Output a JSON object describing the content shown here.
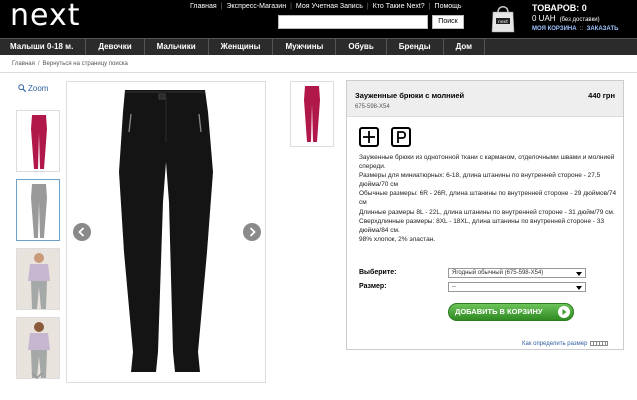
{
  "header": {
    "logo": "next",
    "top_links": [
      "Главная",
      "Экспресс-Магазин",
      "Моя Учетная Запись",
      "Кто Такие Next?",
      "Помощь"
    ],
    "search_button": "Поиск",
    "search_value": "",
    "cart_count": "ТОВАРОВ: 0",
    "cart_sum": "0 UAH",
    "cart_sum_note": "(без доставки)",
    "cart_links": [
      "МОЯ КОРЗИНА",
      "ЗАКАЗАТЬ"
    ]
  },
  "nav": {
    "items": [
      "Малыши 0-18 м.",
      "Девочки",
      "Мальчики",
      "Женщины",
      "Мужчины",
      "Обувь",
      "Бренды",
      "Дом"
    ]
  },
  "breadcrumb": [
    "Главная",
    "Вернуться на страницу поиска"
  ],
  "gallery": {
    "zoom_label": "Zoom"
  },
  "product": {
    "title": "Зауженные брюки с молнией",
    "price": "440 грн",
    "code": "675-598-X54",
    "description": [
      "Зауженные брюки из однотонной ткани с карманом, отделочными швами и молнией спереди.",
      "Размеры для миниатюрных: 6-18, длина штанины по внутренней стороне - 27,5 дюйма/70 см",
      "Обычные размеры: 6R - 26R, длина штанины по внутренней стороне - 29 дюймов/74 см",
      "Длинные размеры 8L - 22L, длина штанины по внутренней стороне - 31 дюйм/79 см.",
      "Сверхдлинные размеры: 8XL - 18XL, длина штанины по внутренней стороне - 33 дюйма/84 см.",
      "98% хлопок, 2% эластан."
    ],
    "select_label": "Выберите:",
    "select_value": "Ягодный обычный (675-598-X54)",
    "size_label": "Размер:",
    "size_value": "--",
    "add_button": "ДОБАВИТЬ В КОРЗИНУ",
    "size_link": "Как определить размер"
  },
  "colors": {
    "header_bg": "#000000",
    "nav_bg": "#2b2b2b",
    "berry": "#b0184a",
    "button_green": "#3f9c2f",
    "link_blue": "#2f5fa0"
  }
}
